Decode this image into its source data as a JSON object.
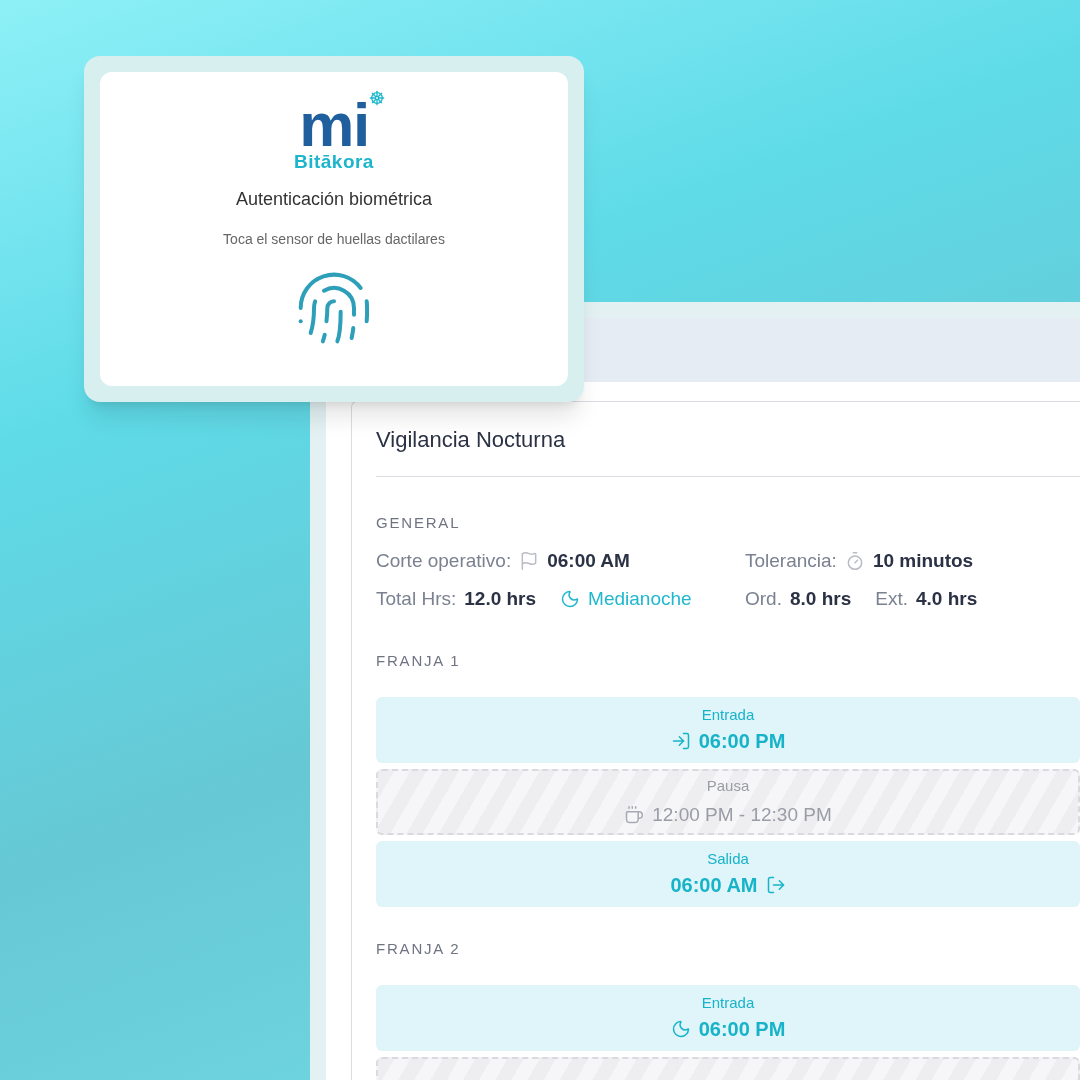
{
  "auth_card": {
    "logo": {
      "mark": "mi",
      "name": "Bitākora"
    },
    "title": "Autenticación biométrica",
    "hint": "Toca el sensor de huellas dactilares"
  },
  "schedule": {
    "title": "Vigilancia Nocturna",
    "general": {
      "heading": "GENERAL",
      "rows": [
        {
          "left": [
            {
              "kind": "cutoff",
              "label": "Corte operativo:",
              "value": "06:00 AM"
            }
          ],
          "right": [
            {
              "kind": "tolerance",
              "label": "Tolerancia:",
              "value": "10 minutos"
            }
          ]
        },
        {
          "left": [
            {
              "kind": "total",
              "label": "Total Hrs:",
              "value": "12.0 hrs"
            },
            {
              "kind": "night",
              "value": "Medianoche"
            }
          ],
          "right": [
            {
              "kind": "plain",
              "label": "Ord.",
              "value": "8.0 hrs"
            },
            {
              "kind": "plain",
              "label": "Ext.",
              "value": "4.0 hrs"
            }
          ]
        }
      ]
    },
    "bands": [
      {
        "heading": "FRANJA 1",
        "segments": [
          {
            "kind": "entrada",
            "label": "Entrada",
            "time": "06:00 PM"
          },
          {
            "kind": "pausa",
            "label": "Pausa",
            "time": "12:00 PM - 12:30 PM"
          },
          {
            "kind": "salida",
            "label": "Salida",
            "time": "06:00 AM"
          }
        ]
      },
      {
        "heading": "FRANJA 2",
        "segments": [
          {
            "kind": "entrada_nocturna",
            "label": "Entrada",
            "time": "06:00 PM"
          },
          {
            "kind": "pausa"
          }
        ]
      }
    ]
  }
}
